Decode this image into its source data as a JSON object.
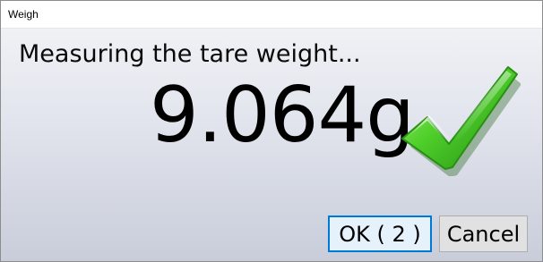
{
  "window": {
    "title": "Weigh"
  },
  "dialog": {
    "message": "Measuring the tare weight...",
    "weight": "9.064g"
  },
  "buttons": {
    "ok_label": "OK ( 2 )",
    "cancel_label": "Cancel"
  },
  "icons": {
    "status": "checkmark-icon"
  },
  "colors": {
    "check_green": "#3cc21e",
    "focus_border": "#0078d7"
  }
}
